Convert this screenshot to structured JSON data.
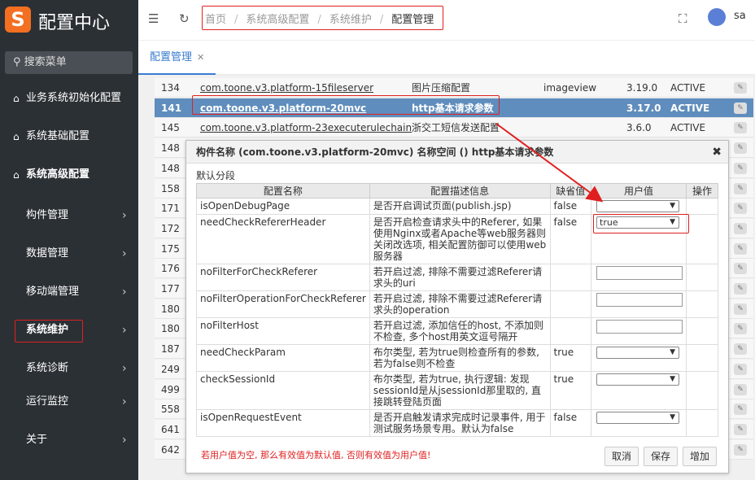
{
  "app": {
    "logo_letter": "S",
    "title": "配置中心"
  },
  "sidebar": {
    "search_placeholder": "搜索菜单",
    "items": [
      {
        "label": "业务系统初始化配置",
        "icon": "home-icon"
      },
      {
        "label": "系统基础配置",
        "icon": "home-icon"
      },
      {
        "label": "系统高级配置",
        "icon": "home-icon"
      },
      {
        "label": "构件管理"
      },
      {
        "label": "数据管理"
      },
      {
        "label": "移动端管理"
      },
      {
        "label": "系统维护"
      },
      {
        "label": "系统诊断"
      },
      {
        "label": "运行监控"
      },
      {
        "label": "关于"
      }
    ]
  },
  "breadcrumb": [
    "首页",
    "系统高级配置",
    "系统维护",
    "配置管理"
  ],
  "user": {
    "name": "sa"
  },
  "tabs": [
    {
      "label": "配置管理"
    }
  ],
  "table": {
    "rows": [
      {
        "id": "134",
        "name": "com.toone.v3.platform-15fileserver",
        "desc": "图片压缩配置",
        "module": "imageview",
        "version": "3.19.0",
        "status": "ACTIVE"
      },
      {
        "id": "141",
        "name": "com.toone.v3.platform-20mvc",
        "desc": "http基本请求参数",
        "module": "",
        "version": "3.17.0",
        "status": "ACTIVE"
      },
      {
        "id": "145",
        "name": "com.toone.v3.platform-23executerulechain",
        "desc": "浙交工短信发送配置",
        "module": "",
        "version": "3.6.0",
        "status": "ACTIVE"
      },
      {
        "id": "148"
      },
      {
        "id": "148"
      },
      {
        "id": "158"
      },
      {
        "id": "171"
      },
      {
        "id": "172"
      },
      {
        "id": "175"
      },
      {
        "id": "176"
      },
      {
        "id": "177"
      },
      {
        "id": "180"
      },
      {
        "id": "180"
      },
      {
        "id": "187"
      },
      {
        "id": "249"
      },
      {
        "id": "499"
      },
      {
        "id": "558"
      },
      {
        "id": "641"
      },
      {
        "id": "642"
      }
    ]
  },
  "modal": {
    "title": "构件名称 (com.toone.v3.platform-20mvc)   名称空间 ()   http基本请求参数",
    "group": "默认分段",
    "headers": [
      "配置名称",
      "配置描述信息",
      "缺省值",
      "用户值",
      "操作"
    ],
    "rows": [
      {
        "name": "isOpenDebugPage",
        "desc": "是否开启调试页面(publish.jsp)",
        "default": "false",
        "value": "",
        "kind": "select"
      },
      {
        "name": "needCheckRefererHeader",
        "desc": "是否开启检查请求头中的Referer, 如果使用Nginx或者Apache等web服务器则关闭改选项, 相关配置防御可以使用web服务器",
        "default": "false",
        "value": "true",
        "kind": "select"
      },
      {
        "name": "noFilterForCheckReferer",
        "desc": "若开启过滤, 排除不需要过滤Referer请求头的uri",
        "default": "",
        "value": "",
        "kind": "input"
      },
      {
        "name": "noFilterOperationForCheckReferer",
        "desc": "若开启过滤, 排除不需要过滤Referer请求头的operation",
        "default": "",
        "value": "",
        "kind": "input"
      },
      {
        "name": "noFilterHost",
        "desc": "若开启过滤, 添加信任的host, 不添加则不检查, 多个host用英文逗号隔开",
        "default": "",
        "value": "",
        "kind": "input"
      },
      {
        "name": "needCheckParam",
        "desc": "布尔类型, 若为true则检查所有的参数, 若为false则不检查",
        "default": "true",
        "value": "",
        "kind": "select"
      },
      {
        "name": "checkSessionId",
        "desc": "布尔类型, 若为true, 执行逻辑: 发现sessionId是从jsessionId那里取的, 直接跳转登陆页面",
        "default": "true",
        "value": "",
        "kind": "select"
      },
      {
        "name": "isOpenRequestEvent",
        "desc": "是否开启触发请求完成时记录事件, 用于测试服务场景专用。默认为false",
        "default": "false",
        "value": "",
        "kind": "select"
      }
    ],
    "warning": "若用户值为空, 那么有效值为默认值, 否则有效值为用户值!",
    "buttons": {
      "cancel": "取消",
      "save": "保存",
      "add": "增加"
    }
  },
  "colors": {
    "accent": "#3a7ccf",
    "highlight": "#e02020",
    "sidebar_bg": "#2b3035",
    "selected_row": "#5f8dbd",
    "logo": "#f36f21"
  }
}
